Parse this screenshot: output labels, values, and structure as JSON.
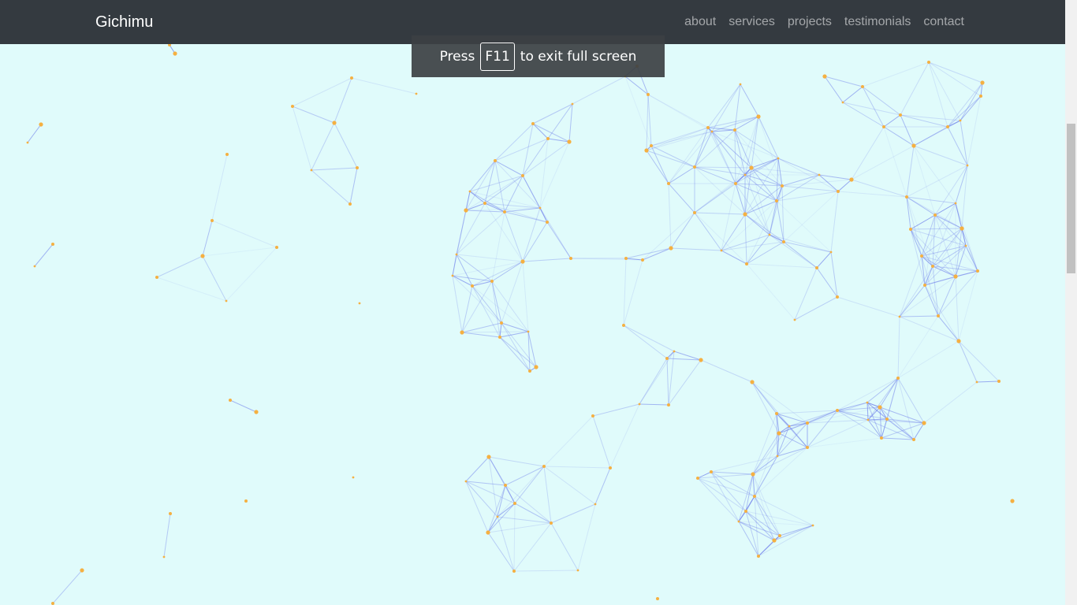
{
  "navbar": {
    "brand": "Gichimu",
    "links": [
      {
        "id": "about",
        "label": "about"
      },
      {
        "id": "services",
        "label": "services"
      },
      {
        "id": "projects",
        "label": "projects"
      },
      {
        "id": "testimonials",
        "label": "testimonials"
      },
      {
        "id": "contact",
        "label": "contact"
      }
    ]
  },
  "fullscreen_notice": {
    "prefix": "Press",
    "key": "F11",
    "suffix": "to exit full screen"
  },
  "colors": {
    "navbar_bg": "#343a40",
    "page_bg": "#e0fbfb",
    "node": "#f5b041",
    "edge": "#6b7bea"
  }
}
